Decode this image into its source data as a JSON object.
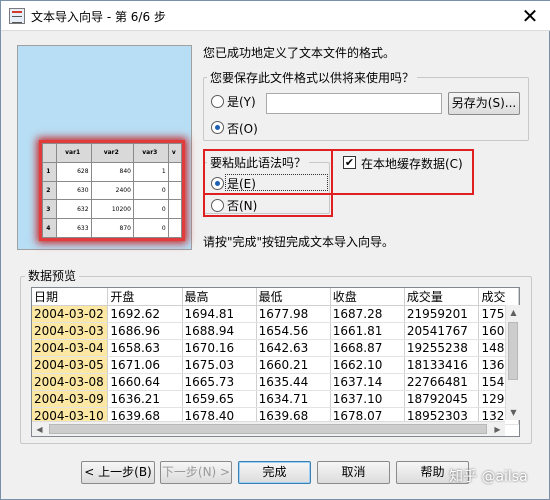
{
  "window": {
    "title": "文本导入向导 - 第 6/6 步",
    "close": "✕"
  },
  "intro": "您已成功地定义了文本文件的格式。",
  "save_format": {
    "question": "您要保存此文件格式以供将来使用吗？",
    "yes_label": "是(Y)",
    "no_label": "否(O)",
    "selected": "no",
    "path_value": "",
    "save_as_button": "另存为(S)..."
  },
  "paste_syntax": {
    "question": "要粘贴此语法吗？",
    "yes_label": "是(E)",
    "no_label": "否(N)",
    "selected": "yes"
  },
  "cache_locally": {
    "label": "在本地缓存数据(C)",
    "checked": true
  },
  "finish_hint": "请按\"完成\"按钮完成文本导入向导。",
  "preview_image": {
    "headers": [
      "",
      "var1",
      "var2",
      "var3",
      "v"
    ],
    "rows": [
      [
        "1",
        "628",
        "840",
        "1",
        ""
      ],
      [
        "2",
        "630",
        "2400",
        "0",
        ""
      ],
      [
        "3",
        "632",
        "10200",
        "0",
        ""
      ],
      [
        "4",
        "633",
        "870",
        "0",
        ""
      ]
    ]
  },
  "data_preview": {
    "legend": "数据预览",
    "columns": [
      "日期",
      "开盘",
      "最高",
      "最低",
      "收盘",
      "成交量",
      "成交"
    ],
    "rows": [
      [
        "2004-03-02",
        "1692.62",
        "1694.81",
        "1677.98",
        "1687.28",
        "21959201",
        "175"
      ],
      [
        "2004-03-03",
        "1686.96",
        "1688.94",
        "1654.56",
        "1661.81",
        "20541767",
        "160"
      ],
      [
        "2004-03-04",
        "1658.63",
        "1670.16",
        "1642.63",
        "1668.87",
        "19255238",
        "148"
      ],
      [
        "2004-03-05",
        "1671.06",
        "1675.03",
        "1660.21",
        "1662.10",
        "18133416",
        "136"
      ],
      [
        "2004-03-08",
        "1660.64",
        "1665.73",
        "1635.44",
        "1637.14",
        "22766481",
        "154"
      ],
      [
        "2004-03-09",
        "1636.21",
        "1659.65",
        "1634.71",
        "1637.10",
        "18792045",
        "129"
      ],
      [
        "2004-03-10",
        "1639.68",
        "1678.40",
        "1639.68",
        "1678.07",
        "18952303",
        "132"
      ]
    ]
  },
  "buttons": {
    "back": "< 上一步(B)",
    "next": "下一步(N) >",
    "finish": "完成",
    "cancel": "取消",
    "help": "帮助"
  },
  "watermark": "知乎 @ailsa",
  "colors": {
    "highlight_red": "#e02020",
    "date_cell": "#fce8a3",
    "radio_dot": "#1a5fb4"
  }
}
